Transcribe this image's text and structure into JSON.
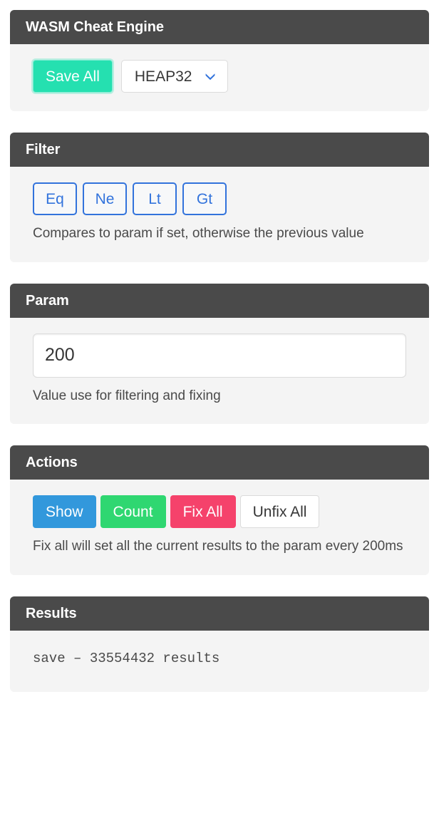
{
  "app": {
    "title": "WASM Cheat Engine"
  },
  "toolbar": {
    "save_all_label": "Save All",
    "heap_select": {
      "value": "HEAP32",
      "icon": "chevron-down-icon"
    }
  },
  "filter": {
    "title": "Filter",
    "buttons": [
      {
        "label": "Eq"
      },
      {
        "label": "Ne"
      },
      {
        "label": "Lt"
      },
      {
        "label": "Gt"
      }
    ],
    "help": "Compares to param if set, otherwise the previous value"
  },
  "param": {
    "title": "Param",
    "value": "200",
    "placeholder": "",
    "help": "Value use for filtering and fixing"
  },
  "actions": {
    "title": "Actions",
    "buttons": [
      {
        "label": "Show"
      },
      {
        "label": "Count"
      },
      {
        "label": "Fix All"
      },
      {
        "label": "Unfix All"
      }
    ],
    "help": "Fix all will set all the current results to the param every 200ms"
  },
  "results": {
    "title": "Results",
    "lines": [
      "save – 33554432 results"
    ]
  },
  "colors": {
    "header_bg": "#4a4a4a",
    "card_bg": "#f4f4f4",
    "save_teal": "#25e0b0",
    "link_blue": "#3273dc",
    "action_blue": "#3298dc",
    "action_green": "#2fd771",
    "action_red": "#f5426b",
    "text_dark": "#363636"
  }
}
